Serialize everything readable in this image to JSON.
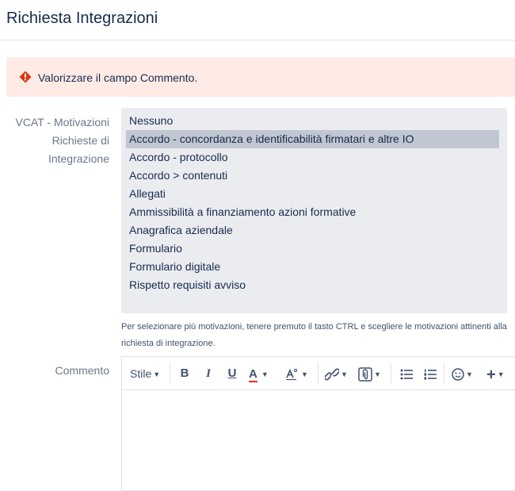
{
  "page": {
    "title": "Richiesta Integrazioni"
  },
  "error": {
    "message": "Valorizzare il campo Commento."
  },
  "form": {
    "motivations_label": "VCAT - Motivazioni Richieste di Integrazione",
    "options": [
      "Nessuno",
      "Accordo - concordanza e identificabilità firmatari e altre IO",
      "Accordo - protocollo",
      "Accordo > contenuti",
      "Allegati",
      "Ammissibilità a finanziamento azioni formative",
      "Anagrafica aziendale",
      "Formulario",
      "Formulario digitale",
      "Rispetto requisiti avviso"
    ],
    "selected_index": 1,
    "help_text": "Per selezionare più motivazioni, tenere premuto il tasto CTRL e scegliere le motivazioni attinenti alla richiesta di integrazione.",
    "comment_label": "Commento"
  },
  "toolbar": {
    "style_label": "Stile",
    "bold": "B",
    "italic": "I",
    "underline": "U",
    "text_color": "A",
    "add": "+"
  },
  "colors": {
    "error_bg": "#ffebe6",
    "error_icon": "#de350b",
    "text_color_underline": "#de350b"
  }
}
